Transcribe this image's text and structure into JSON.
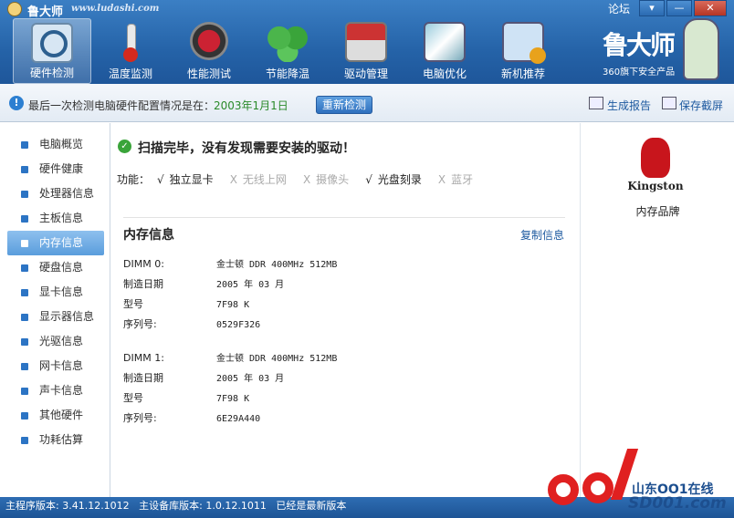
{
  "window": {
    "app_name": "鲁大师",
    "app_url": "www.ludashi.com",
    "forum_link": "论坛",
    "min_button": "▾",
    "restore_button": "—",
    "close_button": "✕"
  },
  "nav": {
    "items": [
      {
        "label": "硬件检测",
        "icon": "hardware-detect-icon",
        "active": true
      },
      {
        "label": "温度监测",
        "icon": "thermometer-icon",
        "active": false
      },
      {
        "label": "性能测试",
        "icon": "speedometer-icon",
        "active": false
      },
      {
        "label": "节能降温",
        "icon": "clover-icon",
        "active": false
      },
      {
        "label": "驱动管理",
        "icon": "driver-box-icon",
        "active": false
      },
      {
        "label": "电脑优化",
        "icon": "monitor-broom-icon",
        "active": false
      },
      {
        "label": "新机推荐",
        "icon": "monitor-medal-icon",
        "active": false
      }
    ]
  },
  "brand": {
    "name": "鲁大师",
    "tagline": "360旗下安全产品"
  },
  "infobar": {
    "text": "最后一次检测电脑硬件配置情况是在：",
    "date": "2003年1月1日",
    "recheck_button": "重新检测",
    "report_label": "生成报告",
    "screenshot_label": "保存截屏"
  },
  "sidebar": {
    "items": [
      {
        "label": "电脑概览",
        "active": false
      },
      {
        "label": "硬件健康",
        "active": false
      },
      {
        "label": "处理器信息",
        "active": false
      },
      {
        "label": "主板信息",
        "active": false
      },
      {
        "label": "内存信息",
        "active": true
      },
      {
        "label": "硬盘信息",
        "active": false
      },
      {
        "label": "显卡信息",
        "active": false
      },
      {
        "label": "显示器信息",
        "active": false
      },
      {
        "label": "光驱信息",
        "active": false
      },
      {
        "label": "网卡信息",
        "active": false
      },
      {
        "label": "声卡信息",
        "active": false
      },
      {
        "label": "其他硬件",
        "active": false
      },
      {
        "label": "功耗估算",
        "active": false
      }
    ]
  },
  "main": {
    "status": "扫描完毕，没有发现需要安装的驱动！",
    "features_label": "功能：",
    "features": [
      {
        "mark": "√",
        "label": "独立显卡",
        "enabled": true
      },
      {
        "mark": "X",
        "label": "无线上网",
        "enabled": false
      },
      {
        "mark": "X",
        "label": "摄像头",
        "enabled": false
      },
      {
        "mark": "√",
        "label": "光盘刻录",
        "enabled": true
      },
      {
        "mark": "X",
        "label": "蓝牙",
        "enabled": false
      }
    ],
    "section_title": "内存信息",
    "copy_link": "复制信息",
    "modules": [
      {
        "rows": [
          {
            "key": "DIMM 0:",
            "value": "金士顿 DDR 400MHz 512MB"
          },
          {
            "key": "制造日期",
            "value": "2005 年 03 月"
          },
          {
            "key": "型号",
            "value": "7F98 K"
          },
          {
            "key": "序列号:",
            "value": "0529F326"
          }
        ]
      },
      {
        "rows": [
          {
            "key": "DIMM 1:",
            "value": "金士顿 DDR 400MHz 512MB"
          },
          {
            "key": "制造日期",
            "value": "2005 年 03 月"
          },
          {
            "key": "型号",
            "value": "7F98 K"
          },
          {
            "key": "序列号:",
            "value": "6E29A440"
          }
        ]
      }
    ]
  },
  "right_panel": {
    "logo_text": "Kingston",
    "brand_label": "内存品牌"
  },
  "statusbar": {
    "text": "主程序版本: 3.41.12.1012   主设备库版本: 1.0.12.1011   已经是最新版本"
  },
  "watermark": {
    "cn": "山东OO1在线",
    "en": "SD001.com"
  }
}
